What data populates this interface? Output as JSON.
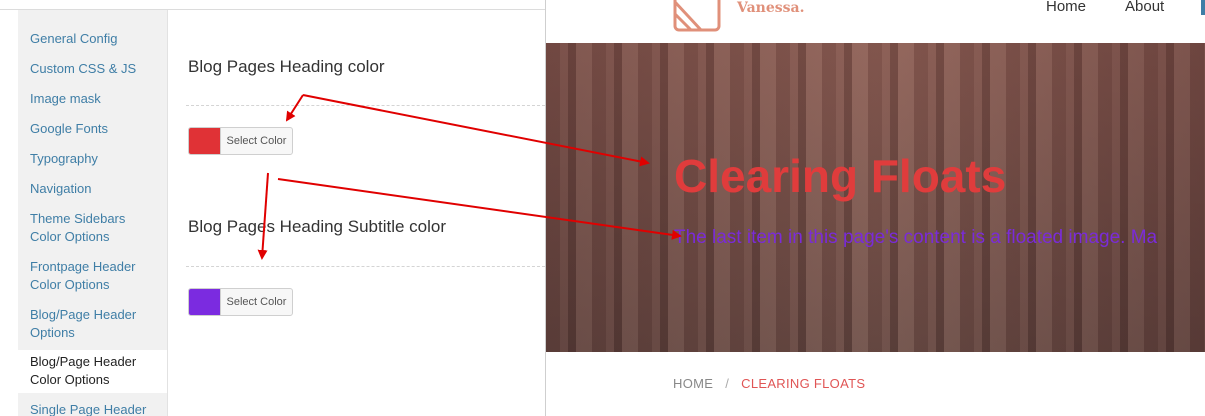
{
  "sidebar": {
    "items": [
      {
        "label": "General Config"
      },
      {
        "label": "Custom CSS & JS"
      },
      {
        "label": "Image mask"
      },
      {
        "label": "Google Fonts"
      },
      {
        "label": "Typography"
      },
      {
        "label": "Navigation"
      },
      {
        "label": "Theme Sidebars Color Options"
      },
      {
        "label": "Frontpage Header Color Options"
      },
      {
        "label": "Blog/Page Header Options"
      },
      {
        "label": "Blog/Page Header Color Options"
      },
      {
        "label": "Single Page Header"
      }
    ],
    "active_index": 9
  },
  "settings": {
    "heading_color": {
      "title": "Blog Pages Heading color",
      "button_label": "Select Color",
      "color": "#e03236"
    },
    "subtitle_color": {
      "title": "Blog Pages Heading Subtitle color",
      "button_label": "Select Color",
      "color": "#7b2be0"
    }
  },
  "preview": {
    "logo_text": "Vanessa.",
    "menu": [
      "Home",
      "About"
    ],
    "hero_title": "Clearing Floats",
    "hero_subtitle": "The last item in this page's content is a floated image. Ma",
    "breadcrumb": {
      "home": "HOME",
      "separator": "/",
      "current": "CLEARING FLOATS"
    }
  },
  "colors": {
    "accent_logo": "#e0907a",
    "annotation_arrow": "#e00000",
    "link": "#3f7ea6"
  }
}
